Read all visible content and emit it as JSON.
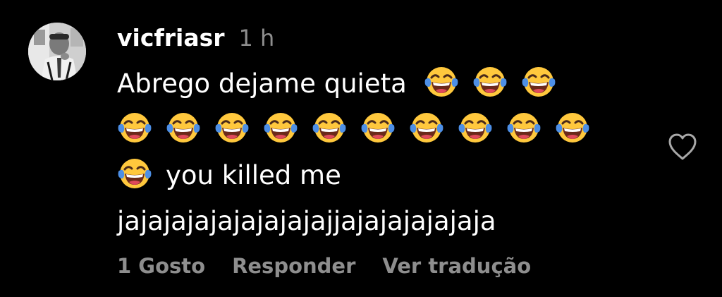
{
  "comment": {
    "username": "vicfriasr",
    "timestamp": "1 h",
    "text_line1": "Abrego dejame quieta",
    "text_line3": "you killed me",
    "text_line4": "jajajajajajajajajajjajajajajajaja",
    "emoji_name": "face-with-tears-of-joy",
    "emoji_counts": {
      "line1": 3,
      "line2": 10,
      "line3": 1
    }
  },
  "actions": {
    "likes": "1 Gosto",
    "reply": "Responder",
    "translate": "Ver tradução"
  },
  "icons": {
    "like": "heart-outline-icon"
  },
  "colors": {
    "background": "#000000",
    "text": "#ffffff",
    "secondary": "#8e8e8e",
    "emoji_face": "#ffc83d",
    "emoji_tears": "#4d8fe6"
  }
}
